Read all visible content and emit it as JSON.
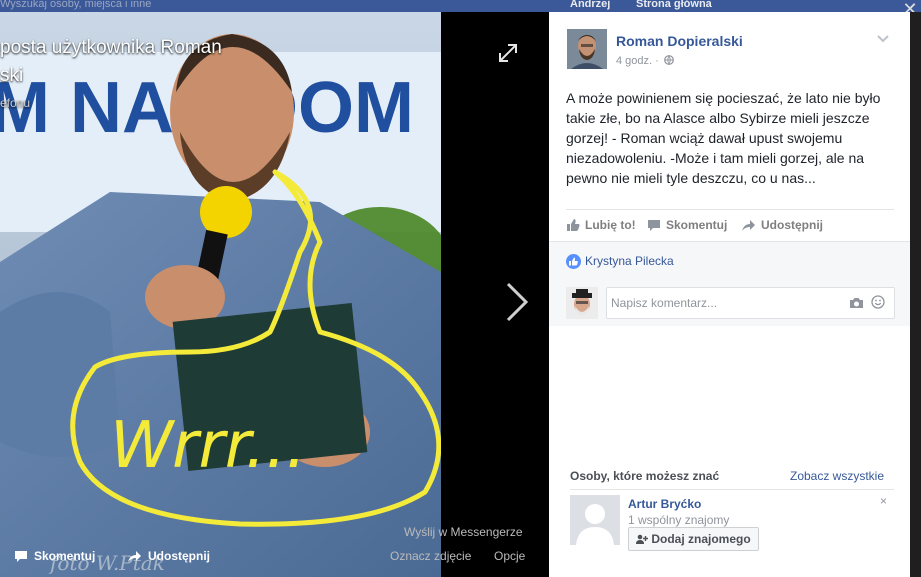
{
  "topbar": {
    "search_text": "Wyszukaj osoby, miejsca i inne",
    "user_name": "Andrzej",
    "home_label": "Strona główna"
  },
  "viewer": {
    "title": "posta użytkownika Roman Dopieralski",
    "title_line1": "posta użytkownika Roman",
    "title_line2": "ski",
    "subtitle": "efonu",
    "handwriting": "Wrrr...",
    "watermark": "foto W.Ptak",
    "comment_label": "Skomentuj",
    "share_label": "Udostępnij",
    "messenger_label": "Wyślij w Messengerze",
    "tag_label": "Oznacz zdjęcie",
    "options_label": "Opcje"
  },
  "post": {
    "author": "Roman Dopieralski",
    "time": "4 godz. ·",
    "text": "A może powinienem się pocieszać, że lato nie było takie złe, bo na Alasce albo Sybirze mieli jeszcze gorzej! - Roman wciąż dawał upust swojemu niezadowoleniu. -Może i tam mieli gorzej, ale na pewno nie mieli tyle deszczu, co u nas...",
    "like_label": "Lubię to!",
    "comment_label": "Skomentuj",
    "share_label": "Udostępnij",
    "liked_by": "Krystyna Pilecka",
    "comment_placeholder": "Napisz komentarz..."
  },
  "pymk": {
    "heading": "Osoby, które możesz znać",
    "see_all": "Zobacz wszystkie",
    "name": "Artur Bryćko",
    "mutual": "1 wspólny znajomy",
    "add_label": "Dodaj znajomego",
    "close": "×"
  },
  "icons": {
    "close": "close-icon",
    "expand": "expand-icon",
    "next": "chevron-right-icon",
    "globe": "globe-icon",
    "chevron": "chevron-down-icon",
    "like": "thumbs-up-icon",
    "comment": "comment-icon",
    "share": "share-icon",
    "camera": "camera-icon",
    "emoji": "smiley-icon",
    "add_friend": "add-friend-icon"
  },
  "colors": {
    "facebook_blue": "#3b5998",
    "link": "#365899",
    "highlight_yellow": "#f4ea3a"
  }
}
